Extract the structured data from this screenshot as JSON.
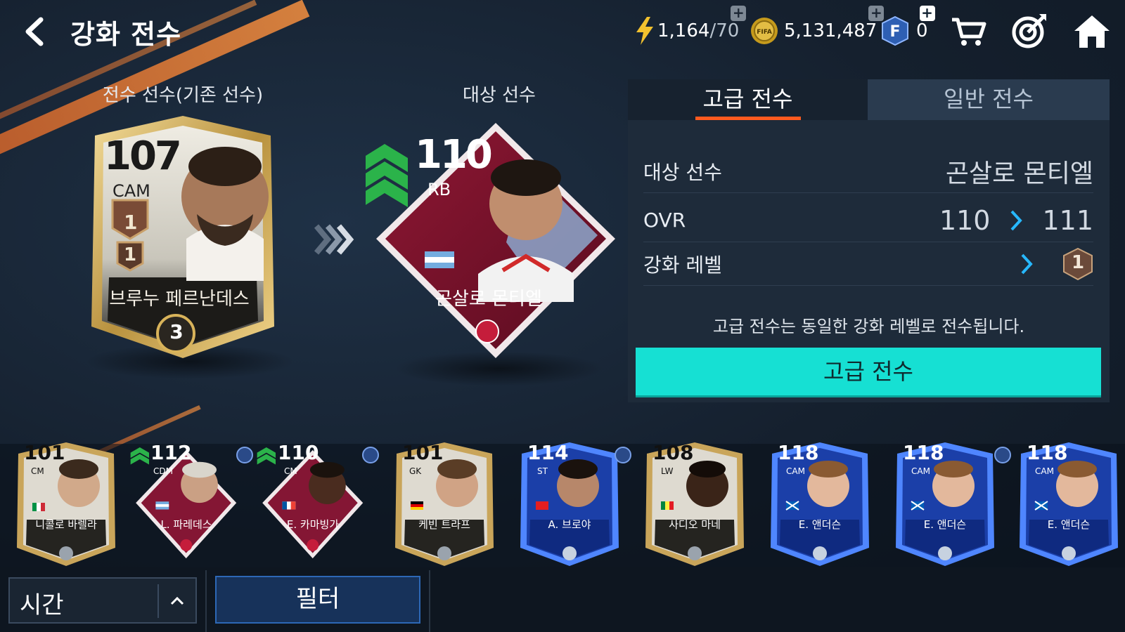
{
  "header": {
    "title": "강화 전수",
    "back_icon": "chevron-left-icon"
  },
  "resources": {
    "energy": {
      "icon": "lightning-icon",
      "value": "1,164",
      "max": "/70"
    },
    "coins": {
      "icon": "fifa-coin-icon",
      "value": "5,131,487"
    },
    "fpoints": {
      "icon": "f-point-icon",
      "value": "0"
    }
  },
  "nav_icons": [
    "cart-icon",
    "target-icon",
    "home-icon"
  ],
  "source": {
    "heading": "전수 선수(기존 선수)",
    "ovr": "107",
    "pos": "CAM",
    "name": "브루누 페르난데스",
    "level": "1",
    "tier": "3"
  },
  "target": {
    "heading": "대상 선수",
    "ovr": "110",
    "pos": "RB",
    "name": "곤살로 몬티엘"
  },
  "panel": {
    "tabs": [
      {
        "label": "고급 전수",
        "active": true
      },
      {
        "label": "일반 전수",
        "active": false
      }
    ],
    "target_label": "대상 선수",
    "target_value": "곤살로 몬티엘",
    "ovr_label": "OVR",
    "ovr_from": "110",
    "ovr_to": "111",
    "level_label": "강화 레벨",
    "level_to": "1",
    "note": "고급 전수는 동일한 강화 레벨로 전수됩니다.",
    "button": "고급 전수"
  },
  "player_list": [
    {
      "ovr": "101",
      "pos": "CM",
      "name": "니콜로 바렐라",
      "style": "gold",
      "locked": false,
      "boost": false
    },
    {
      "ovr": "112",
      "pos": "CDM",
      "name": "L. 파레데스",
      "style": "wc",
      "locked": true,
      "boost": true
    },
    {
      "ovr": "110",
      "pos": "CM",
      "name": "E. 카마빙가",
      "style": "wc",
      "locked": true,
      "boost": true
    },
    {
      "ovr": "101",
      "pos": "GK",
      "name": "케빈 트라프",
      "style": "gold",
      "locked": false,
      "boost": false
    },
    {
      "ovr": "114",
      "pos": "ST",
      "name": "A. 브로야",
      "style": "blue",
      "locked": true,
      "boost": false
    },
    {
      "ovr": "108",
      "pos": "LW",
      "name": "사디오 마네",
      "style": "gold",
      "locked": false,
      "boost": false
    },
    {
      "ovr": "118",
      "pos": "CAM",
      "name": "E. 앤더슨",
      "style": "blue",
      "locked": false,
      "boost": false
    },
    {
      "ovr": "118",
      "pos": "CAM",
      "name": "E. 앤더슨",
      "style": "blue",
      "locked": true,
      "boost": false
    },
    {
      "ovr": "118",
      "pos": "CAM",
      "name": "E. 앤더슨",
      "style": "blue",
      "locked": false,
      "boost": false
    }
  ],
  "bottom": {
    "sort_label": "시간",
    "filter_label": "필터"
  },
  "colors": {
    "accent": "#16e0d3",
    "tab_underline": "#ff5a1f",
    "upgrade_arrow": "#27b8ff"
  }
}
